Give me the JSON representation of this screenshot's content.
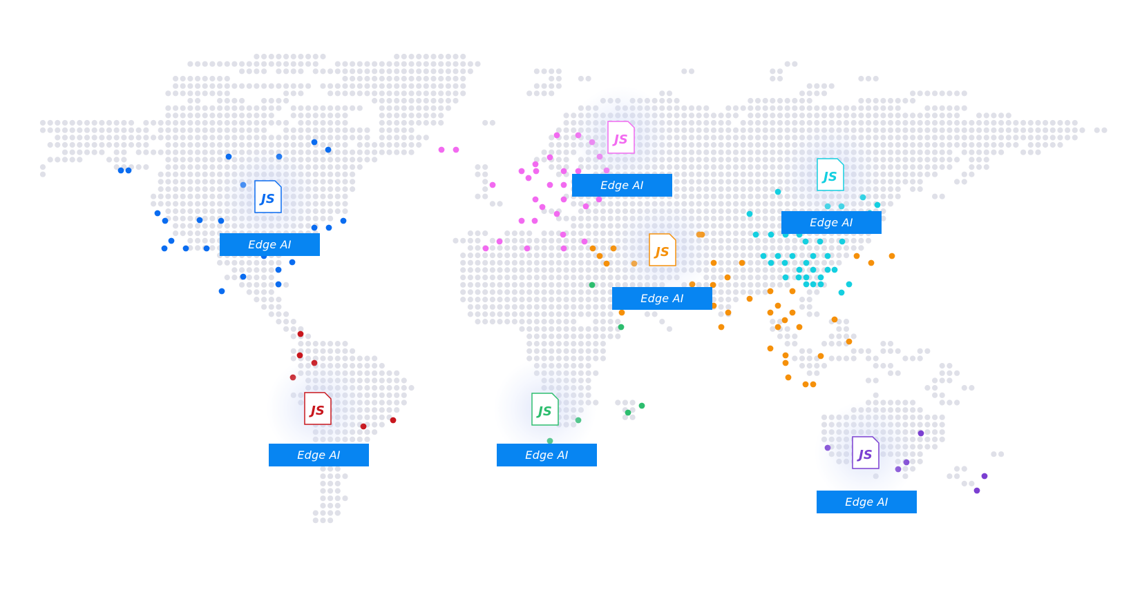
{
  "map": {
    "base_dot_color": "#dfe0e8",
    "regions": [
      {
        "id": "north-america",
        "color": "#0a6cf0",
        "file_label": "JS",
        "badge_label": "Edge AI"
      },
      {
        "id": "south-america",
        "color": "#c8161d",
        "file_label": "JS",
        "badge_label": "Edge AI"
      },
      {
        "id": "europe",
        "color": "#f26af0",
        "file_label": "JS",
        "badge_label": "Edge AI"
      },
      {
        "id": "middle-east-south-asia",
        "color": "#f5900a",
        "file_label": "JS",
        "badge_label": "Edge AI"
      },
      {
        "id": "africa",
        "color": "#2dbd6e",
        "file_label": "JS",
        "badge_label": "Edge AI"
      },
      {
        "id": "east-asia",
        "color": "#14cfe0",
        "file_label": "JS",
        "badge_label": "Edge AI"
      },
      {
        "id": "oceania",
        "color": "#7b3fd1",
        "file_label": "JS",
        "badge_label": "Edge AI"
      }
    ]
  }
}
